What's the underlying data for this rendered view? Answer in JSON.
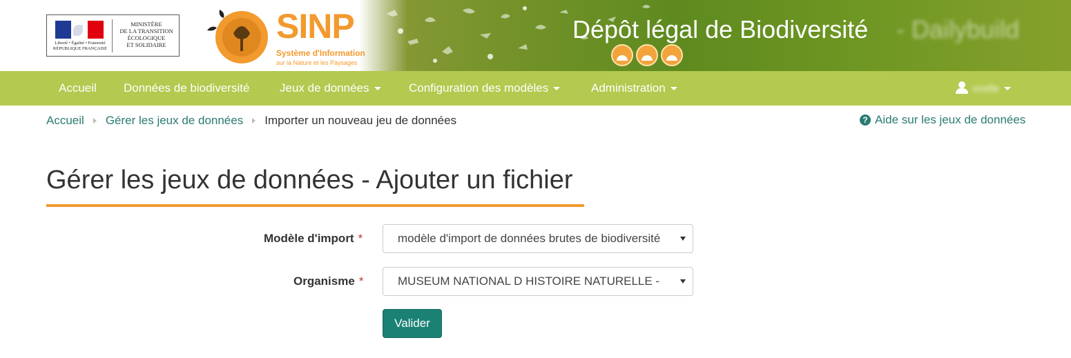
{
  "header": {
    "ministere_text": [
      "MINISTÈRE",
      "DE LA TRANSITION",
      "ÉCOLOGIQUE",
      "ET SOLIDAIRE"
    ],
    "motto": "Liberté • Égalité • Fraternité",
    "republique": "RÉPUBLIQUE FRANÇAISE",
    "sinp_title": "SINP",
    "sinp_subtitle": "Système d'Information",
    "sinp_subtitle2": "sur la Nature et les Paysages",
    "site_title": "Dépôt légal de Biodiversité",
    "build_tag": "- Dailybuild"
  },
  "navbar": {
    "items": [
      {
        "label": "Accueil"
      },
      {
        "label": "Données de biodiversité"
      },
      {
        "label": "Jeux de données"
      },
      {
        "label": "Configuration des modèles"
      },
      {
        "label": "Administration"
      }
    ],
    "user_name": "ocelle"
  },
  "breadcrumb": {
    "items": [
      {
        "label": "Accueil"
      },
      {
        "label": "Gérer les jeux de données"
      },
      {
        "label": "Importer un nouveau jeu de données"
      }
    ],
    "help_label": "Aide sur les jeux de données"
  },
  "page": {
    "title": "Gérer les jeux de données - Ajouter un fichier"
  },
  "form": {
    "model_label": "Modèle d'import",
    "model_value": "modèle d'import de données brutes de biodiversité",
    "organism_label": "Organisme",
    "organism_value": "MUSEUM NATIONAL D HISTOIRE NATURELLE -",
    "required_mark": "*",
    "submit_label": "Valider"
  },
  "colors": {
    "navbar": "#b3c94f",
    "accent_orange": "#f29a2e",
    "link_teal": "#2a7a72",
    "button_teal": "#1a8174"
  }
}
